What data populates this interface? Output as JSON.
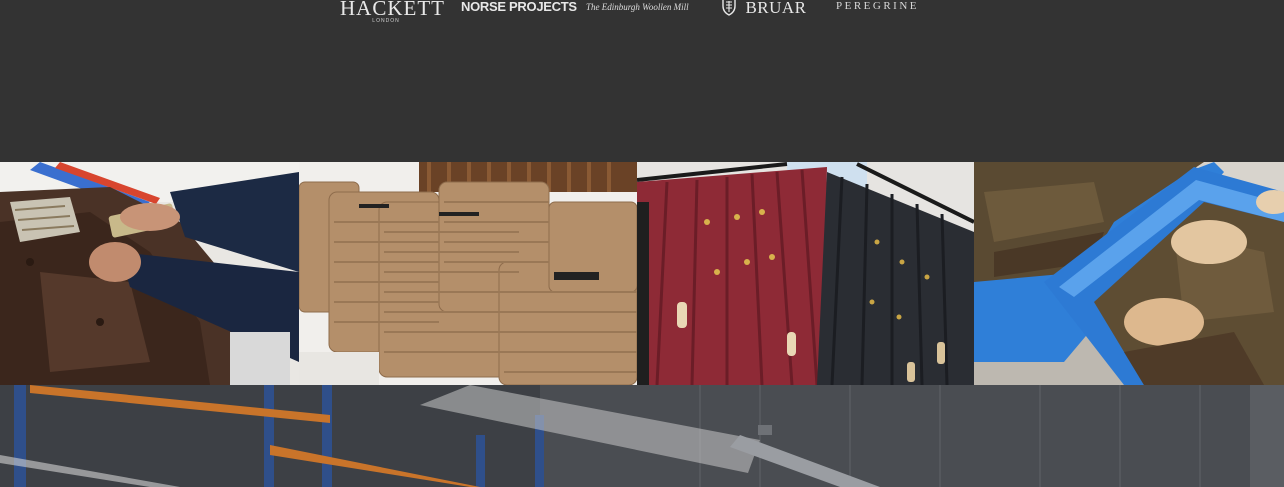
{
  "brand_logos": {
    "hackett": {
      "name": "HACKETT",
      "sub": "LONDON"
    },
    "norse": {
      "name": "NORSE PROJECTS"
    },
    "edinburgh": {
      "name": "The Edinburgh Woollen Mill"
    },
    "bruar": {
      "name": "BRUAR"
    },
    "peregrine": {
      "name": "PEREGRINE"
    }
  },
  "gallery": {
    "tiles": [
      {
        "subject": "waxed-jacket-tagging",
        "icon": "photo-icon"
      },
      {
        "subject": "stacked-tan-jackets",
        "icon": "photo-icon"
      },
      {
        "subject": "duffle-coats-on-rail",
        "icon": "photo-icon"
      },
      {
        "subject": "jackets-in-blue-tubs",
        "icon": "photo-icon"
      }
    ]
  },
  "banner": {
    "subject": "warehouse-racking",
    "icon": "photo-icon"
  },
  "colors": {
    "page_bg": "#333333",
    "logo_text": "#e8e8e8",
    "burgundy_coat": "#8e2a36",
    "navy_coat": "#2a2d33",
    "tan_jacket": "#b08d6a",
    "tub_blue": "#2f7fd8",
    "racking_blue": "#2f4f8a",
    "racking_orange": "#c9742a"
  }
}
